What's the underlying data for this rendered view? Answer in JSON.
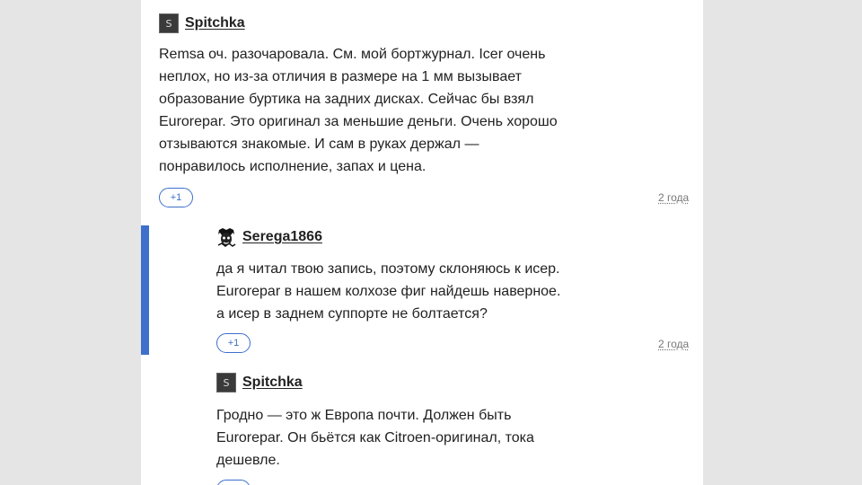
{
  "comments": [
    {
      "author": "Spitchka",
      "avatar_letter": "S",
      "lines": [
        "Remsa оч. разочаровала. См. мой бортжурнал. Icer очень",
        "неплох, но из-за отличия в размере на 1 мм вызывает",
        "образование буртика на задних дисках. Сейчас бы взял",
        "Eurorepar. Это оригинал за меньшие деньги. Очень хорошо",
        "отзываются знакомые. И сам в руках держал —",
        "понравилось исполнение, запах и цена."
      ],
      "plus_label": "+1",
      "time": "2 года"
    },
    {
      "author": "Serega1866",
      "avatar_icon": "face-icon",
      "lines": [
        "да я читал твою запись, поэтому склоняюсь к исер.",
        "Eurorepar в нашем колхозе фиг найдешь наверное.",
        "а исер в заднем суппорте не болтается?"
      ],
      "plus_label": "+1",
      "time": "2 года",
      "highlighted": true
    },
    {
      "author": "Spitchka",
      "avatar_letter": "S",
      "lines": [
        "Гродно — это ж Европа почти. Должен быть",
        "Eurorepar. Он бьётся как Citroen-оригинал, тока",
        "дешевле."
      ]
    }
  ],
  "colors": {
    "accent": "#3d6fcb",
    "page_bg": "#e5e5e5",
    "card_bg": "#ffffff"
  }
}
